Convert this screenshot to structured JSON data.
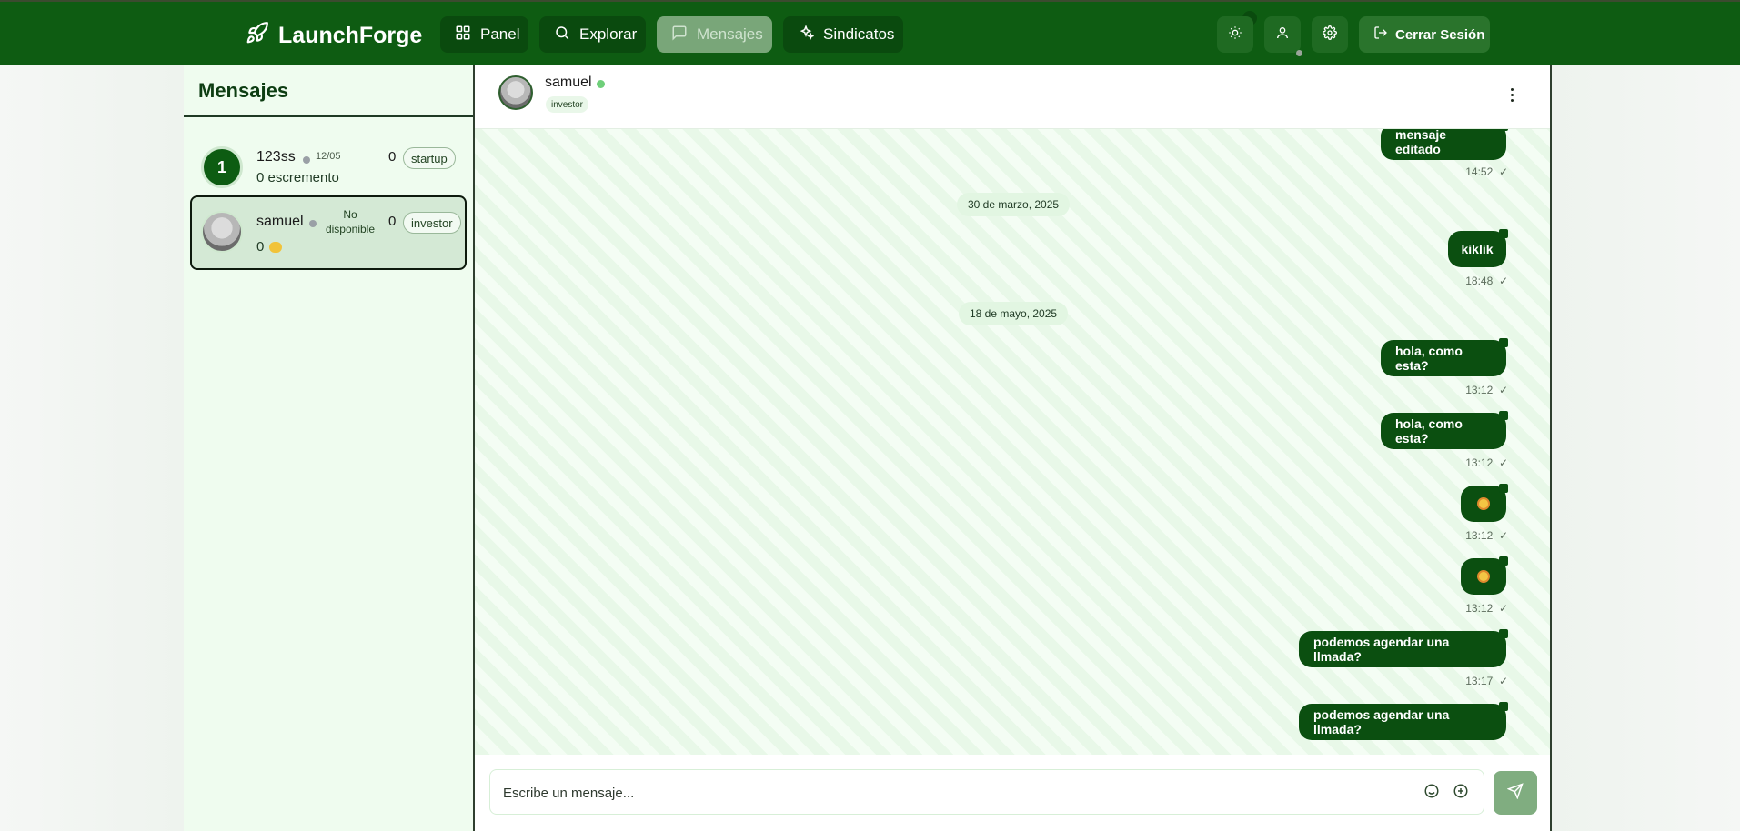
{
  "brand": {
    "name": "LaunchForge"
  },
  "nav": {
    "panel": "Panel",
    "explorar": "Explorar",
    "mensajes": "Mensajes",
    "sindicatos": "Sindicatos",
    "logout": "Cerrar Sesión"
  },
  "sidebar": {
    "title": "Mensajes",
    "conversations": [
      {
        "avatar_text": "1",
        "name": "123ss",
        "date": "12/05",
        "count": "0",
        "role": "startup",
        "last": "0 escremento"
      },
      {
        "name": "samuel",
        "status": "No disponible",
        "count": "0",
        "role": "investor",
        "last": "0"
      }
    ]
  },
  "chat": {
    "name": "samuel",
    "role": "investor",
    "days": [
      "30 de marzo, 2025",
      "18 de mayo, 2025"
    ],
    "messages": [
      {
        "text": "mensaje editado",
        "time": "14:52",
        "check": "✓"
      },
      {
        "text": "kiklik",
        "time": "18:48",
        "check": "✓"
      },
      {
        "text": "hola, como esta?",
        "time": "13:12",
        "check": "✓"
      },
      {
        "text": "hola, como esta?",
        "time": "13:12",
        "check": "✓"
      },
      {
        "text": "",
        "time": "13:12",
        "check": "✓"
      },
      {
        "text": "",
        "time": "13:12",
        "check": "✓"
      },
      {
        "text": "podemos agendar una llmada?",
        "time": "13:17",
        "check": "✓"
      },
      {
        "text": "podemos agendar una llmada?",
        "time": "",
        "check": ""
      }
    ],
    "composer_placeholder": "Escribe un mensaje..."
  },
  "colors": {
    "nav_bg": "#0e5c12",
    "bubble": "#0b4f10",
    "accent_light": "#e2f6e2"
  }
}
